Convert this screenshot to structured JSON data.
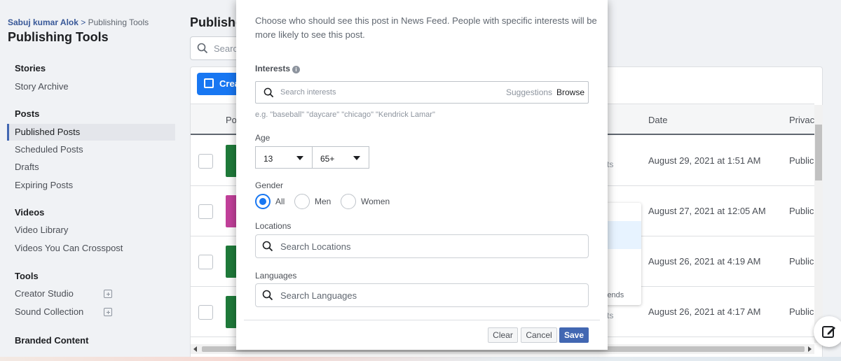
{
  "sidebar": {
    "breadcrumb": {
      "link": "Sabuj kumar Alok",
      "separator": ">",
      "current": "Publishing Tools"
    },
    "title": "Publishing Tools",
    "sections": [
      {
        "heading": "Stories",
        "items": [
          {
            "label": "Story Archive"
          }
        ]
      },
      {
        "heading": "Posts",
        "items": [
          {
            "label": "Published Posts",
            "active": true
          },
          {
            "label": "Scheduled Posts"
          },
          {
            "label": "Drafts"
          },
          {
            "label": "Expiring Posts"
          }
        ]
      },
      {
        "heading": "Videos",
        "items": [
          {
            "label": "Video Library"
          },
          {
            "label": "Videos You Can Crosspost"
          }
        ]
      },
      {
        "heading": "Tools",
        "items": [
          {
            "label": "Creator Studio",
            "external": true
          },
          {
            "label": "Sound Collection",
            "external": true
          }
        ]
      },
      {
        "heading": "Branded Content",
        "items": []
      }
    ]
  },
  "main": {
    "title": "Publishe",
    "search_placeholder": "Searc",
    "create_label": "Crea",
    "columns": {
      "post": "Po",
      "date": "Date",
      "privacy": "Privac"
    },
    "rows": [
      {
        "date": "August 29, 2021 at 1:51 AM",
        "privacy": "Public",
        "fragment": "ts",
        "thumb_color": "#1f7a3a"
      },
      {
        "date": "August 27, 2021 at 12:05 AM",
        "privacy": "Public",
        "fragment": "",
        "thumb_color": "#c2409a"
      },
      {
        "date": "August 26, 2021 at 4:19 AM",
        "privacy": "Public",
        "fragment": "",
        "thumb_color": "#1f7a3a"
      },
      {
        "date": "August 26, 2021 at 4:17 AM",
        "privacy": "Public",
        "fragment": "ts",
        "thumb_color": "#1f7a3a"
      }
    ],
    "dropdown_fragment": "iends"
  },
  "modal": {
    "description": "Choose who should see this post in News Feed. People with specific interests will be more likely to see this post.",
    "interests": {
      "label": "Interests",
      "info_icon": "i",
      "placeholder": "Search interests",
      "suggestions": "Suggestions",
      "browse": "Browse",
      "hint": "e.g. \"baseball\" \"daycare\" \"chicago\" \"Kendrick Lamar\""
    },
    "age": {
      "label": "Age",
      "min": "13",
      "max": "65+"
    },
    "gender": {
      "label": "Gender",
      "options": [
        "All",
        "Men",
        "Women"
      ],
      "selected": "All"
    },
    "locations": {
      "label": "Locations",
      "placeholder": "Search Locations"
    },
    "languages": {
      "label": "Languages",
      "placeholder": "Search Languages"
    },
    "buttons": {
      "clear": "Clear",
      "cancel": "Cancel",
      "save": "Save"
    }
  },
  "colors": {
    "accent": "#1877f2",
    "save": "#4267b2"
  }
}
